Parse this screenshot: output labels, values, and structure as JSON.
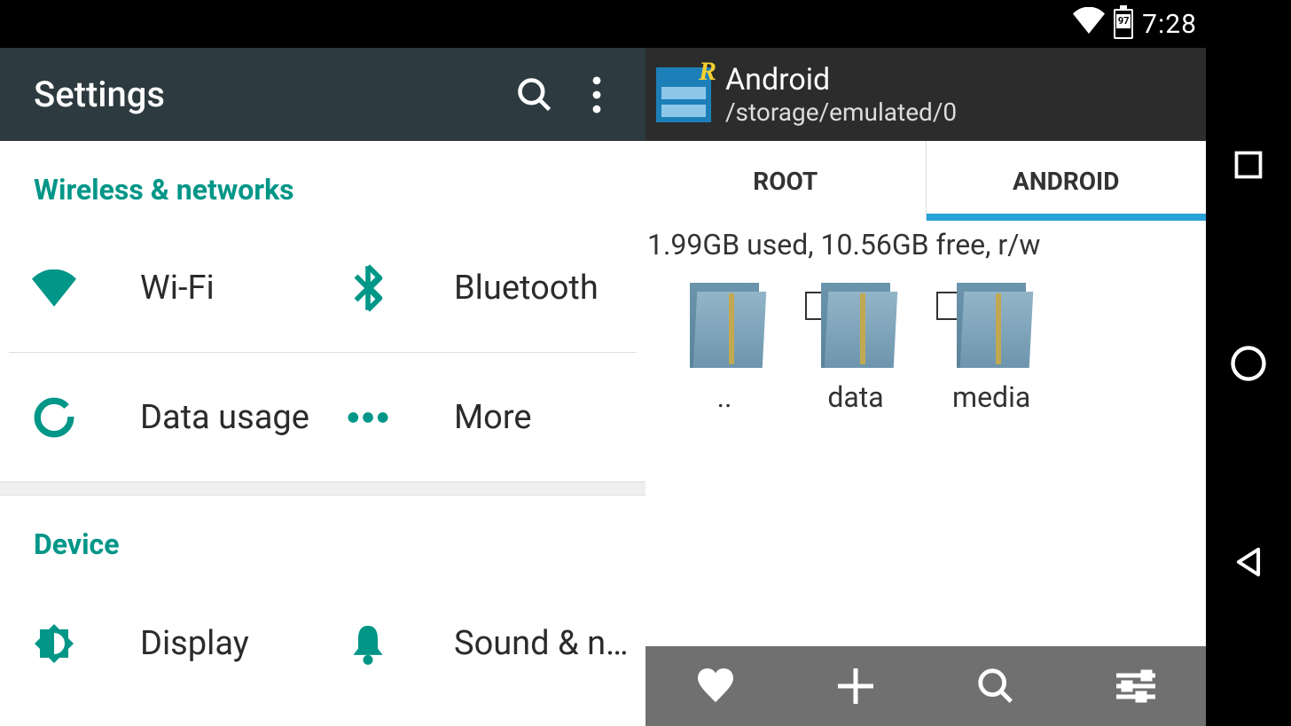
{
  "status": {
    "time": "7:28",
    "battery_pct": "97"
  },
  "settings": {
    "title": "Settings",
    "sections": [
      {
        "label": "Wireless & networks",
        "items": [
          {
            "label": "Wi-Fi"
          },
          {
            "label": "Bluetooth"
          },
          {
            "label": "Data usage"
          },
          {
            "label": "More"
          }
        ]
      },
      {
        "label": "Device",
        "items": [
          {
            "label": "Display"
          },
          {
            "label": "Sound & notification"
          }
        ]
      }
    ]
  },
  "explorer": {
    "title": "Android",
    "path": "/storage/emulated/0",
    "tabs": [
      {
        "label": "ROOT"
      },
      {
        "label": "ANDROID"
      }
    ],
    "storage_status": "1.99GB used, 10.56GB free, r/w",
    "folders": [
      {
        "label": ".."
      },
      {
        "label": "data"
      },
      {
        "label": "media"
      }
    ]
  }
}
